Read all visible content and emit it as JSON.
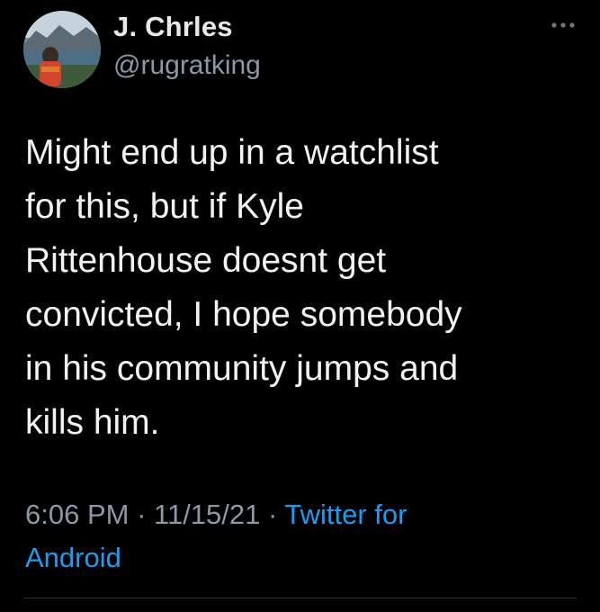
{
  "author": {
    "display_name": "J. Chrles",
    "handle": "@rugratking"
  },
  "tweet": {
    "lines": [
      "Might end up in a watchlist",
      "for this, but if Kyle",
      "Rittenhouse doesnt get",
      "convicted, I hope somebody",
      "in his community jumps and",
      "kills him."
    ],
    "time": "6:06 PM",
    "separator": " · ",
    "date": "11/15/21",
    "source_part1": "Twitter for",
    "source_part2": "Android"
  },
  "icons": {
    "more": "more-horizontal-icon",
    "avatar": "avatar-photo"
  },
  "colors": {
    "background": "#000000",
    "primary_text": "#e7e9ea",
    "secondary_text": "#8b98a5",
    "link": "#1d9bf0",
    "divider": "#2f3336"
  }
}
